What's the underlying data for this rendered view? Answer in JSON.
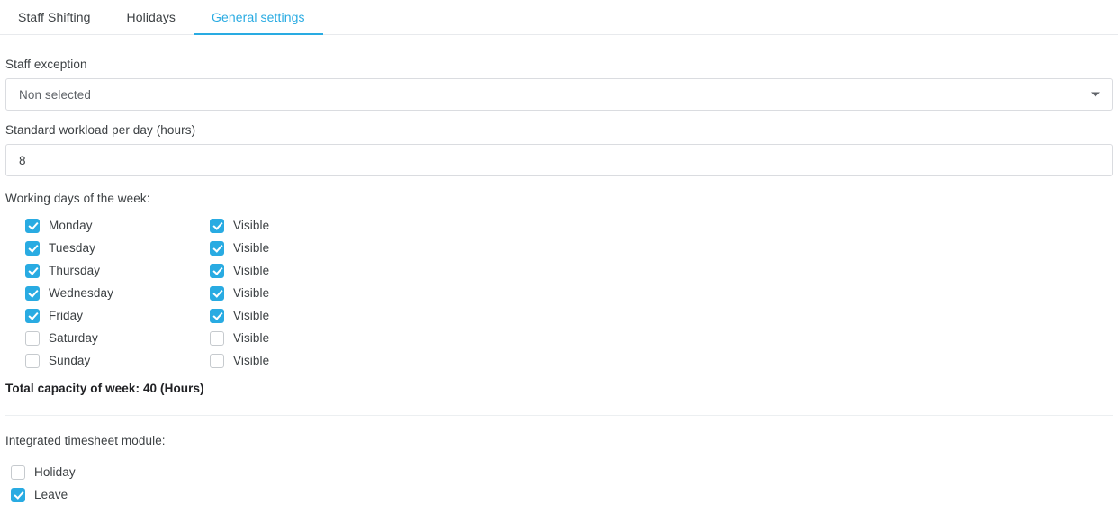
{
  "tabs": [
    {
      "label": "Staff Shifting",
      "active": false
    },
    {
      "label": "Holidays",
      "active": false
    },
    {
      "label": "General settings",
      "active": true
    }
  ],
  "staff_exception": {
    "label": "Staff exception",
    "value": "Non selected",
    "caret_icon": "chevron-down-icon"
  },
  "workload": {
    "label": "Standard workload per day (hours)",
    "value": "8"
  },
  "working_days": {
    "label": "Working days of the week:",
    "visible_label": "Visible",
    "rows": [
      {
        "day": "Monday",
        "checked": true,
        "visible": true
      },
      {
        "day": "Tuesday",
        "checked": true,
        "visible": true
      },
      {
        "day": "Thursday",
        "checked": true,
        "visible": true
      },
      {
        "day": "Wednesday",
        "checked": true,
        "visible": true
      },
      {
        "day": "Friday",
        "checked": true,
        "visible": true
      },
      {
        "day": "Saturday",
        "checked": false,
        "visible": false
      },
      {
        "day": "Sunday",
        "checked": false,
        "visible": false
      }
    ]
  },
  "total_capacity": "Total capacity of week: 40 (Hours)",
  "timesheet": {
    "label": "Integrated timesheet module:",
    "items": [
      {
        "label": "Holiday",
        "checked": false
      },
      {
        "label": "Leave",
        "checked": true
      }
    ]
  },
  "colors": {
    "accent": "#29abe2",
    "text": "#3c4043",
    "border": "#dadce0"
  }
}
